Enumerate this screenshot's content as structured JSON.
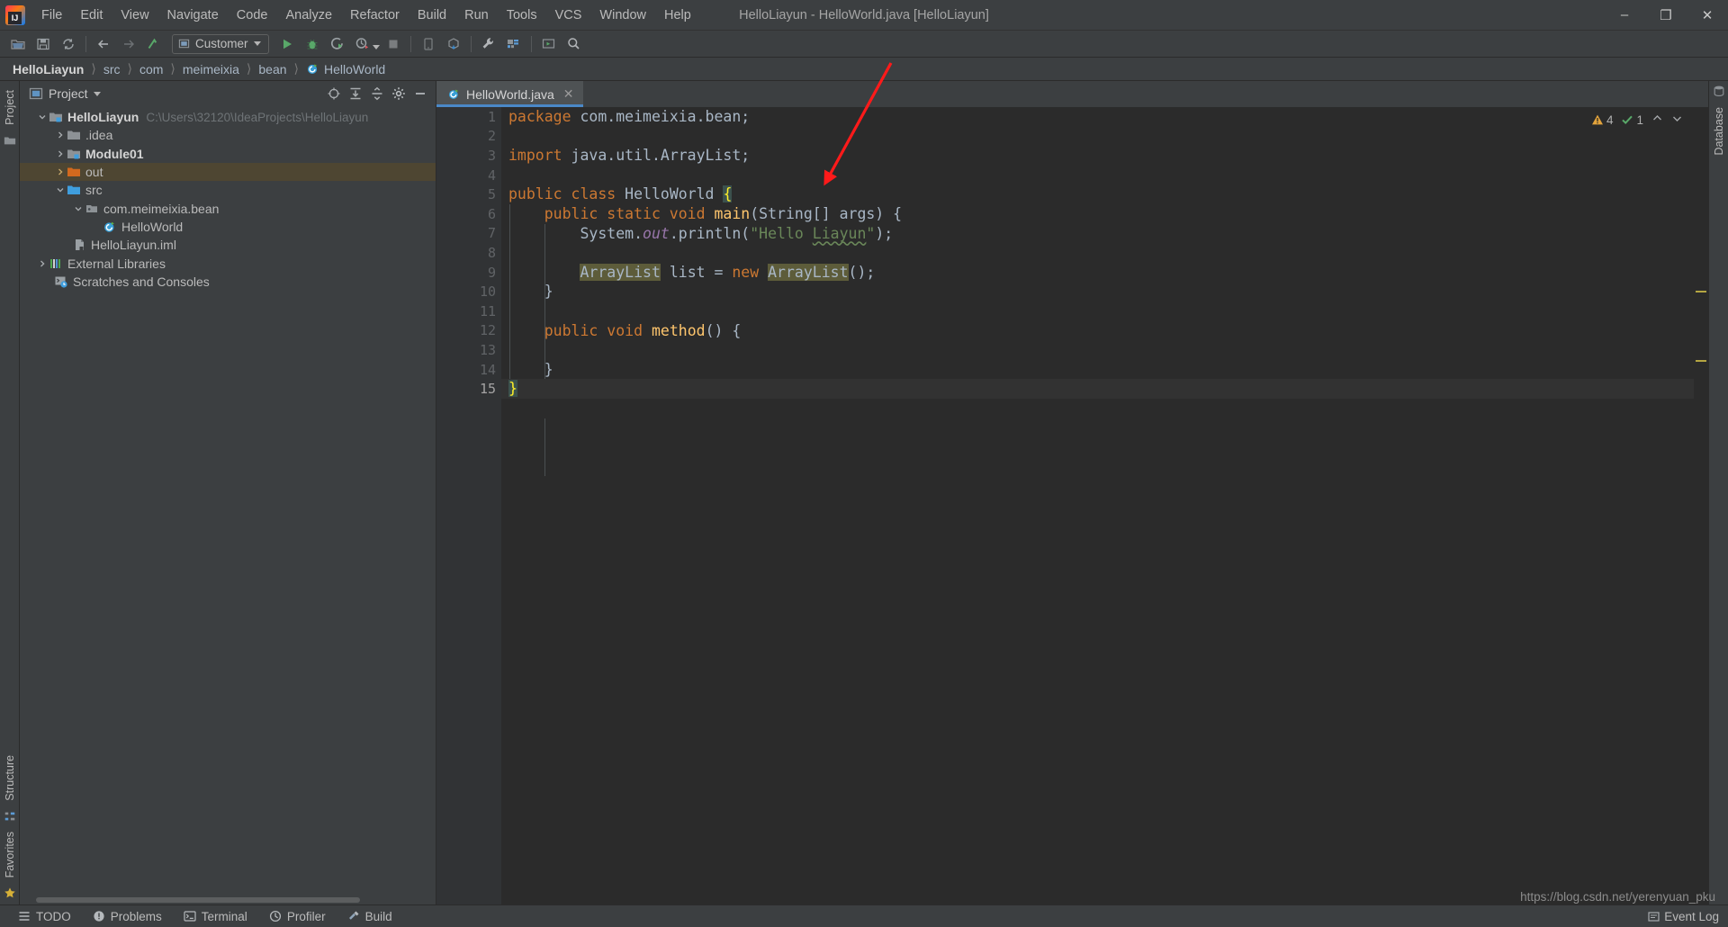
{
  "window": {
    "title": "HelloLiayun - HelloWorld.java [HelloLiayun]",
    "minimize_label": "–",
    "maximize_label": "❐",
    "close_label": "✕",
    "logo_name": "intellij-idea-logo"
  },
  "menubar": [
    {
      "label": "File"
    },
    {
      "label": "Edit"
    },
    {
      "label": "View"
    },
    {
      "label": "Navigate"
    },
    {
      "label": "Code"
    },
    {
      "label": "Analyze"
    },
    {
      "label": "Refactor"
    },
    {
      "label": "Build"
    },
    {
      "label": "Run"
    },
    {
      "label": "Tools"
    },
    {
      "label": "VCS"
    },
    {
      "label": "Window"
    },
    {
      "label": "Help"
    }
  ],
  "toolbar": {
    "run_config": "Customer",
    "buttons": [
      {
        "name": "open-project-icon",
        "glyph": "📁"
      },
      {
        "name": "save-all-icon",
        "glyph": "💾"
      },
      {
        "name": "sync-icon",
        "glyph": "↻"
      },
      {
        "name": "back-icon",
        "glyph": "←"
      },
      {
        "name": "forward-icon",
        "glyph": "→"
      },
      {
        "name": "compile-icon",
        "glyph": "⚙"
      },
      {
        "name": "run-icon",
        "glyph": "▶"
      },
      {
        "name": "debug-icon",
        "glyph": "🐞"
      },
      {
        "name": "run-coverage-icon",
        "glyph": "◑"
      },
      {
        "name": "profile-icon",
        "glyph": "◴"
      },
      {
        "name": "stop-icon",
        "glyph": "■"
      },
      {
        "name": "device-manager-icon",
        "glyph": "□"
      },
      {
        "name": "sdk-manager-icon",
        "glyph": "⬟"
      },
      {
        "name": "settings-icon",
        "glyph": "🔧"
      },
      {
        "name": "project-structure-icon",
        "glyph": "▤"
      },
      {
        "name": "select-opened-file-icon",
        "glyph": "▣"
      },
      {
        "name": "search-everywhere-icon",
        "glyph": "🔍"
      }
    ]
  },
  "breadcrumb": [
    {
      "label": "HelloLiayun",
      "bold": true,
      "icon": ""
    },
    {
      "label": "src",
      "bold": false,
      "icon": ""
    },
    {
      "label": "com",
      "bold": false,
      "icon": ""
    },
    {
      "label": "meimeixia",
      "bold": false,
      "icon": ""
    },
    {
      "label": "bean",
      "bold": false,
      "icon": ""
    },
    {
      "label": "HelloWorld",
      "bold": false,
      "icon": "java-class-icon"
    }
  ],
  "left_rail": {
    "project_label": "Project",
    "structure_label": "Structure",
    "favorites_label": "Favorites"
  },
  "right_rail": {
    "database_label": "Database"
  },
  "project_panel": {
    "title": "Project",
    "actions": [
      {
        "name": "select-opened-file-icon",
        "glyph": "⊕"
      },
      {
        "name": "expand-all-icon",
        "glyph": "⤓"
      },
      {
        "name": "collapse-all-icon",
        "glyph": "⤒"
      },
      {
        "name": "panel-settings-icon",
        "glyph": "⚙"
      },
      {
        "name": "hide-panel-icon",
        "glyph": "–"
      }
    ],
    "tree": [
      {
        "label": "HelloLiayun",
        "path": "C:\\Users\\32120\\IdeaProjects\\HelloLiayun",
        "depth": 0,
        "twist": "open",
        "icon": "project-module-folder-icon",
        "bold": true,
        "selected": false
      },
      {
        "label": ".idea",
        "path": "",
        "depth": 1,
        "twist": "closed",
        "icon": "folder-icon",
        "bold": false,
        "selected": false
      },
      {
        "label": "Module01",
        "path": "",
        "depth": 1,
        "twist": "closed",
        "icon": "module-folder-icon",
        "bold": true,
        "selected": false
      },
      {
        "label": "out",
        "path": "",
        "depth": 1,
        "twist": "closed",
        "icon": "output-folder-icon",
        "bold": false,
        "selected": true
      },
      {
        "label": "src",
        "path": "",
        "depth": 1,
        "twist": "open",
        "icon": "source-folder-icon",
        "bold": false,
        "selected": false
      },
      {
        "label": "com.meimeixia.bean",
        "path": "",
        "depth": 2,
        "twist": "open",
        "icon": "package-icon",
        "bold": false,
        "selected": false
      },
      {
        "label": "HelloWorld",
        "path": "",
        "depth": 3,
        "twist": "none",
        "icon": "java-class-icon",
        "bold": false,
        "selected": false
      },
      {
        "label": "HelloLiayun.iml",
        "path": "",
        "depth": 1,
        "twist": "none",
        "icon": "iml-file-icon",
        "bold": false,
        "selected": false
      },
      {
        "label": "External Libraries",
        "path": "",
        "depth": 0,
        "twist": "closed",
        "icon": "libraries-icon",
        "bold": false,
        "selected": false
      },
      {
        "label": "Scratches and Consoles",
        "path": "",
        "depth": 0,
        "twist": "none",
        "icon": "scratches-icon",
        "bold": false,
        "selected": false
      }
    ]
  },
  "editor": {
    "tab": {
      "label": "HelloWorld.java",
      "icon": "java-class-icon",
      "close": "✕"
    },
    "inspections": {
      "warning_count": "4",
      "warning_icon": "warning-triangle-icon",
      "ok_count": "1",
      "ok_icon": "checkmark-icon",
      "up_arrow": "⌃",
      "down_arrow": "⌄"
    },
    "lines": [
      {
        "n": "1",
        "run": false,
        "fold": "none",
        "indent": 0
      },
      {
        "n": "2",
        "run": false,
        "fold": "none",
        "indent": 0
      },
      {
        "n": "3",
        "run": false,
        "fold": "none",
        "indent": 0
      },
      {
        "n": "4",
        "run": false,
        "fold": "none",
        "indent": 0
      },
      {
        "n": "5",
        "run": true,
        "fold": "none",
        "indent": 0
      },
      {
        "n": "6",
        "run": true,
        "fold": "start",
        "indent": 1
      },
      {
        "n": "7",
        "run": false,
        "fold": "none",
        "indent": 2
      },
      {
        "n": "8",
        "run": false,
        "fold": "none",
        "indent": 2
      },
      {
        "n": "9",
        "run": false,
        "fold": "none",
        "indent": 2
      },
      {
        "n": "10",
        "run": false,
        "fold": "end",
        "indent": 1
      },
      {
        "n": "11",
        "run": false,
        "fold": "none",
        "indent": 0
      },
      {
        "n": "12",
        "run": false,
        "fold": "start",
        "indent": 1
      },
      {
        "n": "13",
        "run": false,
        "fold": "none",
        "indent": 2
      },
      {
        "n": "14",
        "run": false,
        "fold": "end",
        "indent": 1
      },
      {
        "n": "15",
        "run": false,
        "fold": "none",
        "indent": 0
      }
    ],
    "code_text": {
      "l1_kw": "package",
      "l1_rest": " com.meimeixia.bean;",
      "l3_kw": "import",
      "l3_rest": " java.util.ArrayList;",
      "l5_a": "public ",
      "l5_b": "class ",
      "l5_c": "HelloWorld ",
      "l5_brace": "{",
      "l6_a": "    public static void ",
      "l6_m": "main",
      "l6_b": "(String[] args) {",
      "l7_a": "        System.",
      "l7_out": "out",
      "l7_b": ".println(",
      "l7_str_open": "\"Hello ",
      "l7_str_word": "Liayun",
      "l7_str_close": "\"",
      "l7_c": ");",
      "l9_pad": "        ",
      "l9_type": "ArrayList",
      "l9_var": " list ",
      "l9_eq": "= ",
      "l9_new": "new ",
      "l9_ctor": "ArrayList",
      "l9_tail": "();",
      "l10": "    }",
      "l12_a": "    public void ",
      "l12_m": "method",
      "l12_b": "() {",
      "l14": "    }",
      "l15_brace": "}"
    },
    "caret_line_index": 14
  },
  "statusbar": {
    "items": [
      {
        "label": "TODO",
        "icon": "todo-icon"
      },
      {
        "label": "Problems",
        "icon": "problems-icon"
      },
      {
        "label": "Terminal",
        "icon": "terminal-icon"
      },
      {
        "label": "Profiler",
        "icon": "profiler-icon"
      },
      {
        "label": "Build",
        "icon": "build-hammer-icon"
      }
    ],
    "event_log": "Event Log",
    "event_log_icon": "event-log-icon"
  },
  "watermark": "https://blog.csdn.net/yerenyuan_pku",
  "colors": {
    "accent_blue": "#4a88c7",
    "keyword_orange": "#cc7832",
    "string_green": "#6a8759",
    "method_yellow": "#ffc66d",
    "field_purple": "#9876aa",
    "selection_olive": "#4e4632",
    "annotation_red": "#ff1a1a",
    "run_green": "#59a869",
    "warning_yellow": "#e2a33c",
    "panel_bg": "#3c3f41",
    "editor_bg": "#2b2b2b",
    "gutter_bg": "#313335"
  }
}
